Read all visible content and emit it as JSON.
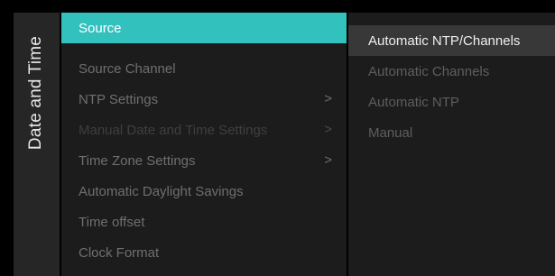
{
  "sidebar": {
    "title": "Date and Time"
  },
  "menu": {
    "items": [
      {
        "label": "Source",
        "chevron": ""
      },
      {
        "label": "Source Channel",
        "chevron": ""
      },
      {
        "label": "NTP Settings",
        "chevron": ">"
      },
      {
        "label": "Manual Date and Time Settings",
        "chevron": ">"
      },
      {
        "label": "Time Zone Settings",
        "chevron": ">"
      },
      {
        "label": "Automatic Daylight Savings",
        "chevron": ""
      },
      {
        "label": "Time offset",
        "chevron": ""
      },
      {
        "label": "Clock Format",
        "chevron": ""
      }
    ]
  },
  "options": {
    "items": [
      {
        "label": "Automatic NTP/Channels"
      },
      {
        "label": "Automatic Channels"
      },
      {
        "label": "Automatic NTP"
      },
      {
        "label": "Manual"
      }
    ]
  },
  "colors": {
    "accent": "#32c1bd",
    "background": "#000000",
    "panel": "#1c1c1c",
    "sidebar": "#262626"
  }
}
